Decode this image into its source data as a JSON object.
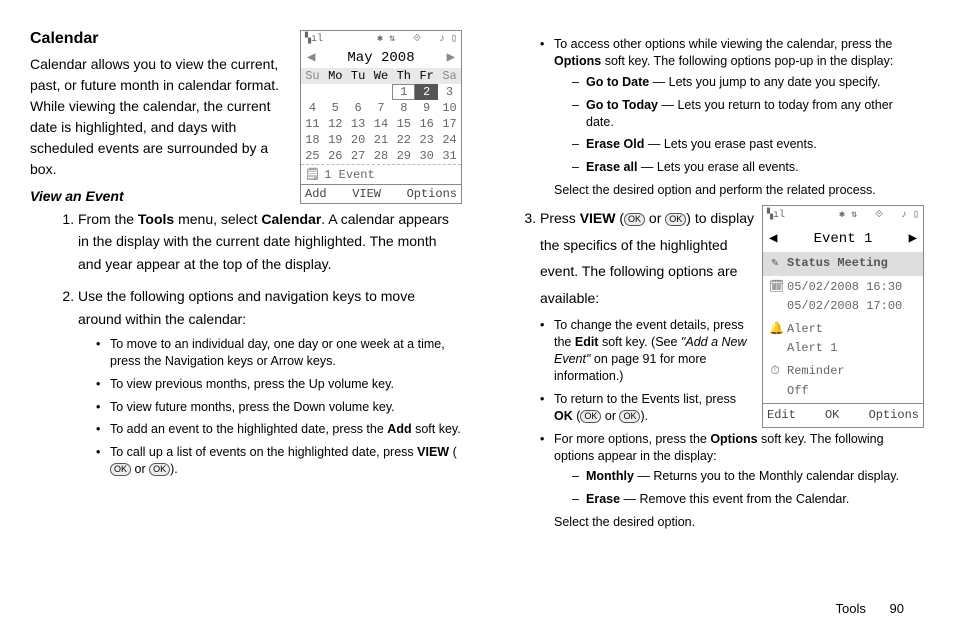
{
  "left": {
    "heading": "Calendar",
    "intro": "Calendar allows you to view the current, past, or future month in calendar format. While viewing the calendar, the current date is highlighted, and days with scheduled events are surrounded by a box.",
    "sub": "View an Event",
    "step1_a": "From the ",
    "step1_tools": "Tools",
    "step1_b": " menu, select ",
    "step1_cal": "Calendar",
    "step1_c": ". A calendar appears in the display with the current date highlighted. The month and year appear at the top of the display.",
    "step2": "Use the following options and navigation keys to move around within the calendar:",
    "b1": "To move to an individual day, one day or one week at a time, press the Navigation keys or Arrow keys.",
    "b2": "To view previous months, press the Up volume key.",
    "b3": "To view future months, press the Down volume key.",
    "b4_a": "To add an event to the highlighted date, press the ",
    "b4_add": "Add",
    "b4_b": " soft key.",
    "b5_a": "To call up a list of events on the highlighted date, press ",
    "b5_view": "VIEW",
    "b5_b": " (",
    "b5_or": " or ",
    "b5_c": ")."
  },
  "right": {
    "b1_a": "To access other options while viewing the calendar, press the ",
    "b1_opt": "Options",
    "b1_b": " soft key. The following options pop-up in the display:",
    "d1_t": "Go to Date",
    "d1": " — Lets you jump to any date you specify.",
    "d2_t": "Go to Today",
    "d2": " — Lets you return to today from any other date.",
    "d3_t": "Erase Old",
    "d3": " — Lets you erase past events.",
    "d4_t": "Erase all",
    "d4": " — Lets you erase all events.",
    "d_end": "Select the desired option and perform the related process.",
    "s3_a": "Press ",
    "s3_view": "VIEW",
    "s3_b": " (",
    "s3_or": " or ",
    "s3_c": ") to display the specifics of the highlighted event. The following options are available:",
    "rb1_a": "To change the event details, press the ",
    "rb1_edit": "Edit",
    "rb1_b": " soft key. (See ",
    "rb1_ref": "\"Add a New Event\"",
    "rb1_c": " on page 91 for more information.)",
    "rb2_a": "To return to the Events list, press ",
    "rb2_ok": "OK",
    "rb2_b": " (",
    "rb2_or": " or ",
    "rb2_c": ").",
    "rb3_a": "For more options, press the ",
    "rb3_opt": "Options",
    "rb3_b": " soft key. The following options appear in the display:",
    "rd1_t": "Monthly",
    "rd1": " — Returns you to the Monthly calendar display.",
    "rd2_t": "Erase",
    "rd2": " — Remove this event from the Calendar.",
    "rd_end": "Select the desired option."
  },
  "phone1": {
    "title": "May 2008",
    "days": [
      "Su",
      "Mo",
      "Tu",
      "We",
      "Th",
      "Fr",
      "Sa"
    ],
    "row1": [
      "",
      "",
      "",
      "",
      "1",
      "2",
      "3"
    ],
    "row2": [
      "4",
      "5",
      "6",
      "7",
      "8",
      "9",
      "10"
    ],
    "row3": [
      "11",
      "12",
      "13",
      "14",
      "15",
      "16",
      "17"
    ],
    "row4": [
      "18",
      "19",
      "20",
      "21",
      "22",
      "23",
      "24"
    ],
    "row5": [
      "25",
      "26",
      "27",
      "28",
      "29",
      "30",
      "31"
    ],
    "evcount": "1 Event",
    "sk_l": "Add",
    "sk_c": "VIEW",
    "sk_r": "Options"
  },
  "phone2": {
    "title": "Event 1",
    "subject": "Status Meeting",
    "date1": "05/02/2008 16:30",
    "date2": "05/02/2008 17:00",
    "alert_l": "Alert",
    "alert_v": "Alert 1",
    "rem_l": "Reminder",
    "rem_v": "Off",
    "sk_l": "Edit",
    "sk_c": "OK",
    "sk_r": "Options"
  },
  "footer": {
    "section": "Tools",
    "page": "90"
  },
  "ok": "OK"
}
